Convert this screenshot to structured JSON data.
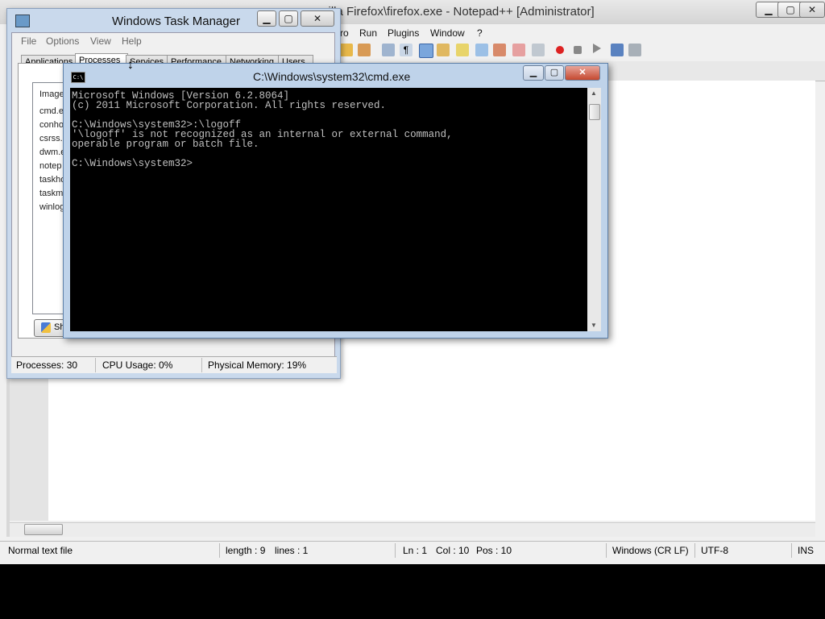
{
  "notepadpp": {
    "title": "zilla Firefox\\firefox.exe - Notepad++ [Administrator]",
    "menu": [
      "ro",
      "Run",
      "Plugins",
      "Window",
      "?"
    ],
    "status": {
      "file_type": "Normal text file",
      "length": "length : 9",
      "lines": "lines : 1",
      "ln": "Ln : 1",
      "col": "Col : 10",
      "pos": "Pos : 10",
      "eol": "Windows (CR LF)",
      "encoding": "UTF-8",
      "mode": "INS"
    }
  },
  "taskmanager": {
    "title": "Windows Task Manager",
    "menu": [
      "File",
      "Options",
      "View",
      "Help"
    ],
    "tabs": [
      "Applications",
      "Processes",
      "Services",
      "Performance",
      "Networking",
      "Users"
    ],
    "list_header": "Image",
    "processes": [
      "cmd.e",
      "conho",
      "csrss.",
      "dwm.e",
      "notep",
      "taskho",
      "taskm",
      "winlog"
    ],
    "show_button": "Sh",
    "status": {
      "processes": "Processes: 30",
      "cpu": "CPU Usage: 0%",
      "memory": "Physical Memory: 19%"
    }
  },
  "cmd": {
    "title": "C:\\Windows\\system32\\cmd.exe",
    "icon_label": "C:\\",
    "console_text": "Microsoft Windows [Version 6.2.8064]\n(c) 2011 Microsoft Corporation. All rights reserved.\n\nC:\\Windows\\system32>:\\logoff\n'\\logoff' is not recognized as an internal or external command,\noperable program or batch file.\n\nC:\\Windows\\system32>"
  }
}
